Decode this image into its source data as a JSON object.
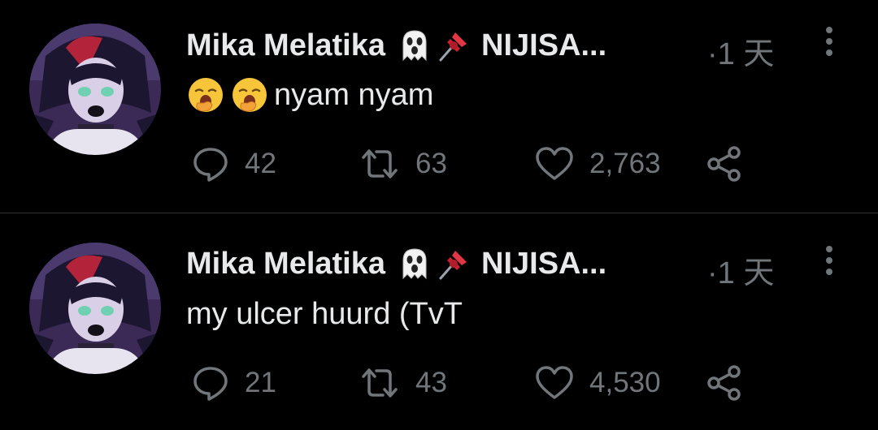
{
  "tweets": [
    {
      "author": {
        "display_name": "Mika Melatika",
        "badges": [
          "ghost-emoji",
          "pushpin-emoji"
        ],
        "handle": "NIJISA..."
      },
      "timestamp": "·1 天",
      "text": "nyam nyam",
      "text_emojis": [
        "yawning-face-emoji",
        "yawning-face-emoji"
      ],
      "actions": {
        "replies": "42",
        "retweets": "63",
        "likes": "2,763"
      }
    },
    {
      "author": {
        "display_name": "Mika Melatika",
        "badges": [
          "ghost-emoji",
          "pushpin-emoji"
        ],
        "handle": "NIJISA..."
      },
      "timestamp": "·1 天",
      "text": "my ulcer huurd (TvT",
      "text_emojis": [],
      "actions": {
        "replies": "21",
        "retweets": "43",
        "likes": "4,530"
      }
    }
  ],
  "icons": {
    "reply": "speech-bubble-icon",
    "retweet": "retweet-arrows-icon",
    "like": "heart-icon",
    "share": "share-nodes-icon",
    "more": "vertical-dots-icon"
  },
  "colors": {
    "background": "#000000",
    "primary_text": "#e7e9ea",
    "secondary_text": "#71767b",
    "divider": "#2f3336"
  }
}
